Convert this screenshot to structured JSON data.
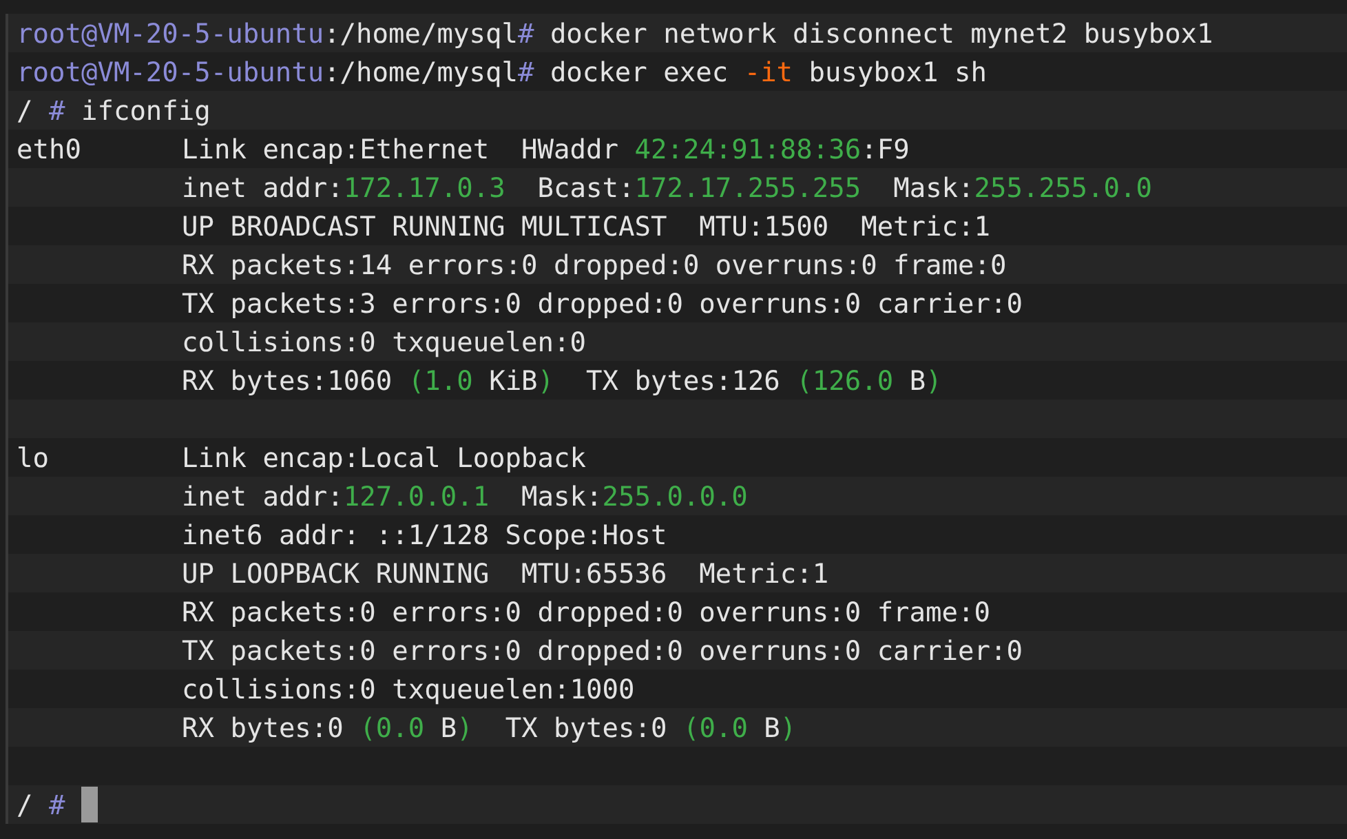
{
  "terminal": {
    "lines": [
      {
        "kind": "command",
        "segments": [
          {
            "text": "root@VM-20-5-ubuntu",
            "kind": "prompt"
          },
          {
            "text": ":/home/mysql",
            "kind": "text"
          },
          {
            "text": "#",
            "kind": "prompt"
          },
          {
            "text": " docker network disconnect mynet2 busybox1",
            "kind": "text"
          }
        ]
      },
      {
        "kind": "command",
        "segments": [
          {
            "text": "root@VM-20-5-ubuntu",
            "kind": "prompt"
          },
          {
            "text": ":/home/mysql",
            "kind": "text"
          },
          {
            "text": "#",
            "kind": "prompt"
          },
          {
            "text": " docker exec ",
            "kind": "text"
          },
          {
            "text": "-it",
            "kind": "flag"
          },
          {
            "text": " busybox1 sh",
            "kind": "text"
          }
        ]
      },
      {
        "kind": "command",
        "segments": [
          {
            "text": "/ ",
            "kind": "text"
          },
          {
            "text": "#",
            "kind": "prompt"
          },
          {
            "text": " ifconfig",
            "kind": "text"
          }
        ]
      },
      {
        "kind": "detail",
        "label": "eth0",
        "segments": [
          {
            "text": "Link encap:Ethernet  HWaddr ",
            "kind": "text"
          },
          {
            "text": "42:24:91:88:36",
            "kind": "value"
          },
          {
            "text": ":F9",
            "kind": "text"
          }
        ]
      },
      {
        "kind": "detail",
        "segments": [
          {
            "text": "inet addr:",
            "kind": "text"
          },
          {
            "text": "172.17.0.3",
            "kind": "value"
          },
          {
            "text": "  Bcast:",
            "kind": "text"
          },
          {
            "text": "172.17.255.255",
            "kind": "value"
          },
          {
            "text": "  Mask:",
            "kind": "text"
          },
          {
            "text": "255.255.0.0",
            "kind": "value"
          }
        ]
      },
      {
        "kind": "detail",
        "segments": [
          {
            "text": "UP BROADCAST RUNNING MULTICAST  MTU:1500  Metric:1",
            "kind": "text"
          }
        ]
      },
      {
        "kind": "detail",
        "segments": [
          {
            "text": "RX packets:14 errors:0 dropped:0 overruns:0 frame:0",
            "kind": "text"
          }
        ]
      },
      {
        "kind": "detail",
        "segments": [
          {
            "text": "TX packets:3 errors:0 dropped:0 overruns:0 carrier:0",
            "kind": "text"
          }
        ]
      },
      {
        "kind": "detail",
        "segments": [
          {
            "text": "collisions:0 txqueuelen:0",
            "kind": "text"
          }
        ]
      },
      {
        "kind": "detail",
        "segments": [
          {
            "text": "RX bytes:1060 ",
            "kind": "text"
          },
          {
            "text": "(1.0 ",
            "kind": "value"
          },
          {
            "text": "KiB",
            "kind": "text"
          },
          {
            "text": ")",
            "kind": "value"
          },
          {
            "text": "  TX bytes:126 ",
            "kind": "text"
          },
          {
            "text": "(126.0 ",
            "kind": "value"
          },
          {
            "text": "B",
            "kind": "text"
          },
          {
            "text": ")",
            "kind": "value"
          }
        ]
      },
      {
        "kind": "blank"
      },
      {
        "kind": "detail",
        "label": "lo",
        "segments": [
          {
            "text": "Link encap:Local Loopback",
            "kind": "text"
          }
        ]
      },
      {
        "kind": "detail",
        "segments": [
          {
            "text": "inet addr:",
            "kind": "text"
          },
          {
            "text": "127.0.0.1",
            "kind": "value"
          },
          {
            "text": "  Mask:",
            "kind": "text"
          },
          {
            "text": "255.0.0.0",
            "kind": "value"
          }
        ]
      },
      {
        "kind": "detail",
        "segments": [
          {
            "text": "inet6 addr: ::1/128 Scope:Host",
            "kind": "text"
          }
        ]
      },
      {
        "kind": "detail",
        "segments": [
          {
            "text": "UP LOOPBACK RUNNING  MTU:65536  Metric:1",
            "kind": "text"
          }
        ]
      },
      {
        "kind": "detail",
        "segments": [
          {
            "text": "RX packets:0 errors:0 dropped:0 overruns:0 frame:0",
            "kind": "text"
          }
        ]
      },
      {
        "kind": "detail",
        "segments": [
          {
            "text": "TX packets:0 errors:0 dropped:0 overruns:0 carrier:0",
            "kind": "text"
          }
        ]
      },
      {
        "kind": "detail",
        "segments": [
          {
            "text": "collisions:0 txqueuelen:1000",
            "kind": "text"
          }
        ]
      },
      {
        "kind": "detail",
        "segments": [
          {
            "text": "RX bytes:0 ",
            "kind": "text"
          },
          {
            "text": "(0.0 ",
            "kind": "value"
          },
          {
            "text": "B",
            "kind": "text"
          },
          {
            "text": ")",
            "kind": "value"
          },
          {
            "text": "  TX bytes:0 ",
            "kind": "text"
          },
          {
            "text": "(0.0 ",
            "kind": "value"
          },
          {
            "text": "B",
            "kind": "text"
          },
          {
            "text": ")",
            "kind": "value"
          }
        ]
      },
      {
        "kind": "blank"
      },
      {
        "kind": "input",
        "segments": [
          {
            "text": "/ ",
            "kind": "text"
          },
          {
            "text": "#",
            "kind": "prompt"
          }
        ]
      }
    ]
  }
}
